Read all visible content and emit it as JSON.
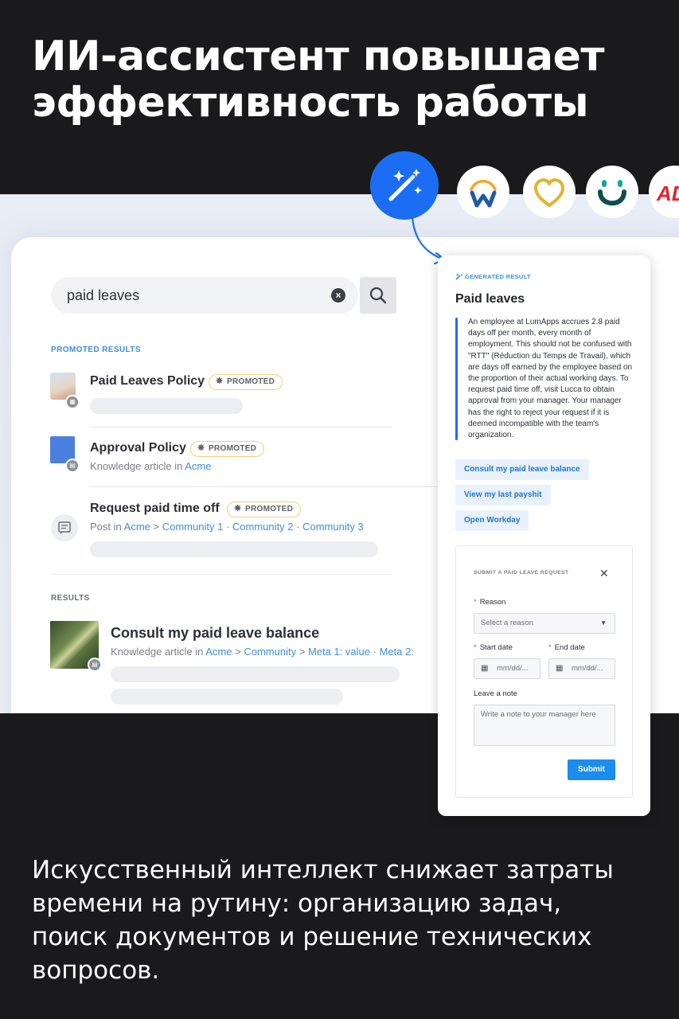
{
  "headline": {
    "line1": "ИИ-ассистент повышает",
    "line2": "эффективность работы"
  },
  "subtext": {
    "line1": "Искусственный интеллект снижает затраты",
    "line2": "времени на рутину: организацию задач,",
    "line3": "поиск документов и решение технических",
    "line4": "вопросов."
  },
  "app_logos": [
    "workday-logo",
    "heart-logo",
    "smile-logo",
    "adp-logo"
  ],
  "adp_text": "AD",
  "search": {
    "query": "paid leaves",
    "clear_glyph": "×"
  },
  "promoted": {
    "section_label": "PROMOTED RESULTS",
    "badge_label": "PROMOTED",
    "items": [
      {
        "title": "Paid Leaves Policy"
      },
      {
        "title": "Approval Policy",
        "meta_prefix": "Knowledge article in",
        "meta_link": "Acme"
      },
      {
        "title": "Request paid time off",
        "meta_prefix": "Post in",
        "meta_link1": "Acme",
        "sep1": ">",
        "meta_link2": "Community 1",
        "sep2": "·",
        "meta_link3": "Community 2",
        "sep3": "·",
        "meta_link4": "Community 3"
      }
    ]
  },
  "results": {
    "section_label": "RESULTS",
    "items": [
      {
        "title": "Consult my paid leave balance",
        "meta_prefix": "Knowledge article in",
        "meta_link1": "Acme",
        "sep1": ">",
        "meta_link2": "Community",
        "sep2": ">",
        "meta_link3": "Meta 1: value",
        "sep3": "·",
        "meta_link4": "Meta 2:"
      }
    ]
  },
  "generated": {
    "label": "GENERATED RESULT",
    "title": "Paid leaves",
    "body": "An employee at LumApps accrues 2.8 paid days off per month, every month of employment. This should not be confused with \"RTT\" (Réduction du Temps de Travail), which are days off earned by the employee based on the proportion of their actual working days. To request paid time off, visit Lucca to obtain approval from your manager. Your manager has the right to reject your request if it is deemed incompatible with the team's organization.",
    "actions": [
      "Consult my paid leave balance",
      "View my last payshit",
      "Open Workday"
    ]
  },
  "form": {
    "title": "SUBMIT A PAID LEAVE REQUEST",
    "close_glyph": "✕",
    "required_mark": "*",
    "reason_label": "Reason",
    "reason_placeholder": "Select a reason",
    "start_label": "Start date",
    "end_label": "End date",
    "date_placeholder": "mm/dd/...",
    "note_label": "Leave a note",
    "note_placeholder": "Write a note to your manager here",
    "submit_label": "Submit"
  },
  "colors": {
    "accent_blue": "#1b6ef3",
    "link_blue": "#3d8fdd",
    "promoted_border": "#f2d27a",
    "dark_bg": "#1a1a1c"
  }
}
